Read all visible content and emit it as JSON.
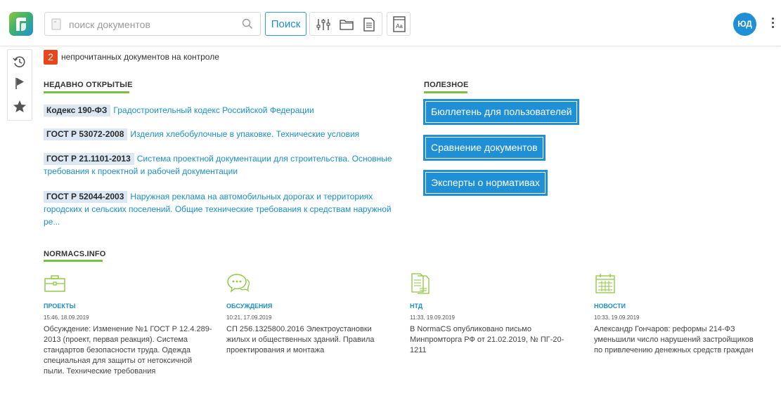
{
  "header": {
    "search_placeholder": "поиск документов",
    "search_button": "Поиск",
    "tool_aa_label": "Aa",
    "user_initials": "ЮД"
  },
  "sidebar": {
    "items": [
      "history-icon",
      "flag-icon",
      "star-icon"
    ]
  },
  "unread": {
    "count": "2",
    "text": "непрочитанных документов на контроле"
  },
  "recent": {
    "title": "НЕДАВНО ОТКРЫТЫЕ",
    "items": [
      {
        "code": "Кодекс 190-ФЗ",
        "title": "Градостроительный кодекс Российской Федерации"
      },
      {
        "code": "ГОСТ Р 53072-2008",
        "title": "Изделия хлебобулочные в упаковке. Технические условия"
      },
      {
        "code": "ГОСТ Р 21.1101-2013",
        "title": "Система проектной документации для строительства. Основные требования к проектной и рабочей документации"
      },
      {
        "code": "ГОСТ Р 52044-2003",
        "title": "Наружная реклама на автомобильных дорогах и территориях городских и сельских поселений. Общие технические требования к средствам наружной ре..."
      }
    ]
  },
  "useful": {
    "title": "ПОЛЕЗНОЕ",
    "buttons": [
      "Бюллетень для пользователей",
      "Сравнение документов",
      "Эксперты о нормативах"
    ]
  },
  "normacs": {
    "title": "NORMACS.INFO",
    "news": [
      {
        "icon": "briefcase-icon",
        "category": "ПРОЕКТЫ",
        "time": "15:46, 18.09.2019",
        "text": "Обсуждение: Изменение №1 ГОСТ Р 12.4.289-2013 (проект, первая реакция). Система стандартов безопасности труда. Одежда специальная для защиты от нетоксичной пыли. Технические требования"
      },
      {
        "icon": "chat-icon",
        "category": "ОБСУЖДЕНИЯ",
        "time": "10:21, 17.09.2019",
        "text": "СП 256.1325800.2016 Электроустановки жилых и общественных зданий. Правила проектирования и монтажа"
      },
      {
        "icon": "document-icon",
        "category": "НТД",
        "time": "11:33, 19.09.2019",
        "text": "В NormaCS опубликовано письмо Минпромторга РФ от 21.02.2019, № ПГ-20-1211"
      },
      {
        "icon": "calendar-icon",
        "category": "НОВОСТИ",
        "time": "10:33, 19.09.2019",
        "text": "Александр Гончаров: реформы 214-ФЗ уменьшили число нарушений застройщиков по привлечению денежных средств граждан"
      }
    ]
  },
  "colors": {
    "accent": "#1f8fd6",
    "green": "#7ac142",
    "badge": "#e8471d",
    "code_bg": "#dbe8f3"
  }
}
